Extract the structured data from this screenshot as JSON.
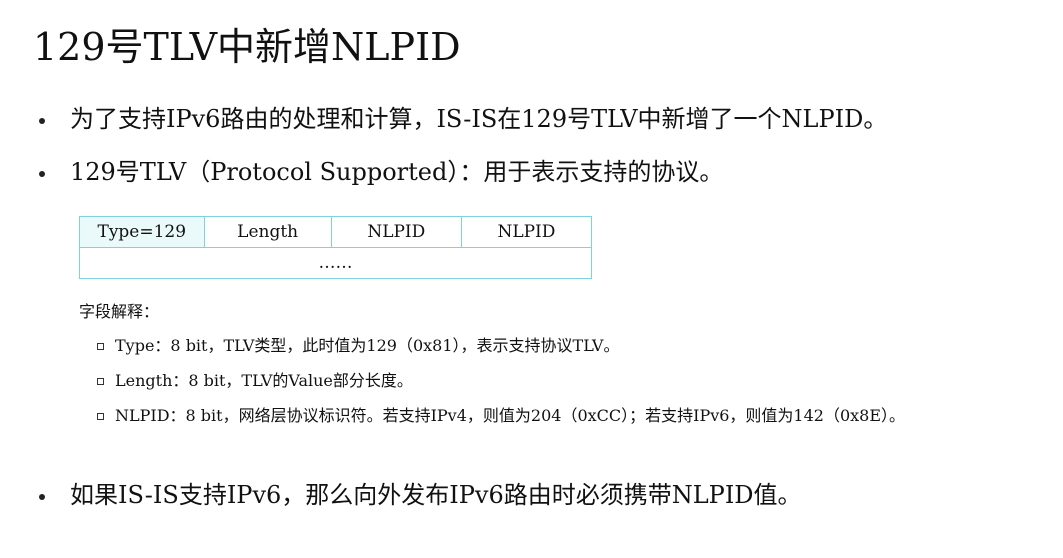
{
  "title": "129号TLV中新增NLPID",
  "bullets": [
    "为了支持IPv6路由的处理和计算，IS-IS在129号TLV中新增了一个NLPID。",
    "129号TLV（Protocol Supported）：用于表示支持的协议。",
    "如果IS-IS支持IPv6，那么向外发布IPv6路由时必须携带NLPID值。"
  ],
  "tlv_table": {
    "row1": [
      "Type=129",
      "Length",
      "NLPID",
      "NLPID"
    ],
    "row2": "……"
  },
  "legend": {
    "title": "字段解释：",
    "items": [
      "Type：8 bit，TLV类型，此时值为129（0x81），表示支持协议TLV。",
      "Length：8 bit，TLV的Value部分长度。",
      "NLPID：8 bit，网络层协议标识符。若支持IPv4，则值为204（0xCC）；若支持IPv6，则值为142（0x8E）。"
    ]
  },
  "colors": {
    "table_border": "#7fd3dd",
    "type_cell_bg": "#eafafb",
    "text": "#111111"
  }
}
